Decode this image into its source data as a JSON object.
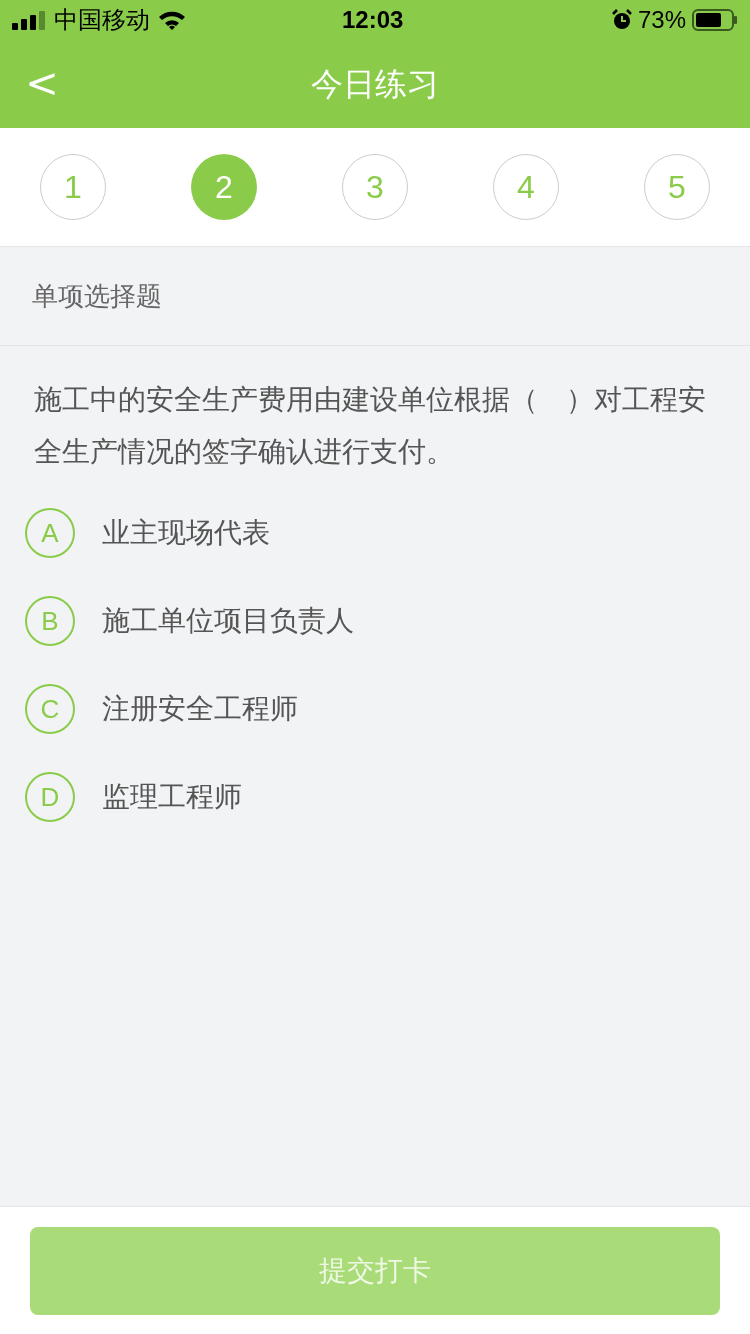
{
  "status_bar": {
    "carrier": "中国移动",
    "time": "12:03",
    "battery": "73%"
  },
  "nav": {
    "back": "<",
    "title": "今日练习"
  },
  "steps": [
    {
      "label": "1",
      "selected": false
    },
    {
      "label": "2",
      "selected": true
    },
    {
      "label": "3",
      "selected": false
    },
    {
      "label": "4",
      "selected": false
    },
    {
      "label": "5",
      "selected": false
    }
  ],
  "section": "单项选择题",
  "question": "施工中的安全生产费用由建设单位根据（　）对工程安全生产情况的签字确认进行支付。",
  "options": [
    {
      "letter": "A",
      "text": "业主现场代表",
      "selected": false
    },
    {
      "letter": "B",
      "text": "施工单位项目负责人",
      "selected": false
    },
    {
      "letter": "C",
      "text": "注册安全工程师",
      "selected": false
    },
    {
      "letter": "D",
      "text": "监理工程师",
      "selected": false
    }
  ],
  "submit": {
    "label": "提交打卡",
    "disabled": true
  }
}
